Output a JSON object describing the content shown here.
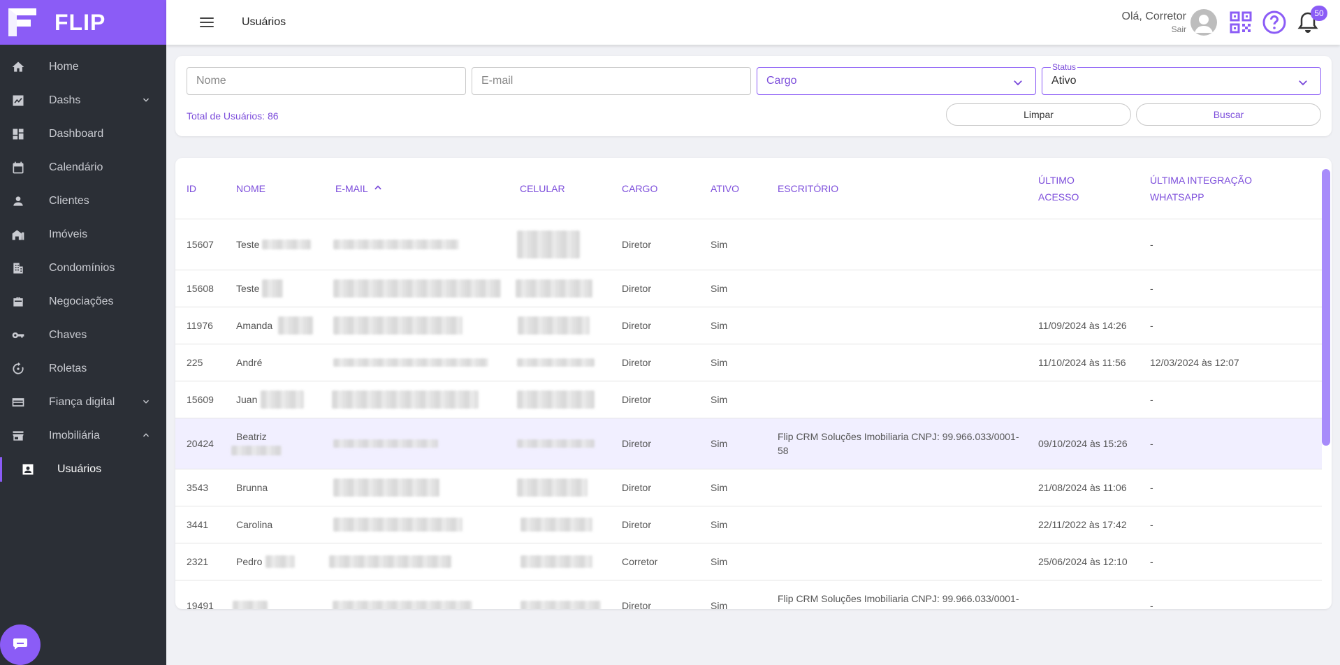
{
  "brand": {
    "name": "FLIP",
    "accent": "#8b5cf6"
  },
  "sidebar": {
    "items": [
      {
        "label": "Home",
        "icon": "home-icon"
      },
      {
        "label": "Dashs",
        "icon": "chart-icon"
      },
      {
        "label": "Dashboard",
        "icon": "dashboard-icon"
      },
      {
        "label": "Calendário",
        "icon": "calendar-icon"
      },
      {
        "label": "Clientes",
        "icon": "person-icon"
      },
      {
        "label": "Imóveis",
        "icon": "house-icon"
      },
      {
        "label": "Condomínios",
        "icon": "building-icon"
      },
      {
        "label": "Negociações",
        "icon": "briefcase-icon"
      },
      {
        "label": "Chaves",
        "icon": "key-icon"
      },
      {
        "label": "Roletas",
        "icon": "roulette-icon"
      },
      {
        "label": "Fiança digital",
        "icon": "credit-card-icon"
      },
      {
        "label": "Imobiliária",
        "icon": "store-icon"
      },
      {
        "label": "Usuários",
        "icon": "user-badge-icon"
      }
    ]
  },
  "header": {
    "title": "Usuários",
    "greeting": "Olá, Corretor",
    "logout": "Sair",
    "notifications": "50"
  },
  "filters": {
    "name_placeholder": "Nome",
    "email_placeholder": "E-mail",
    "cargo_placeholder": "Cargo",
    "status_label": "Status",
    "status_value": "Ativo",
    "total": "Total de Usuários: 86",
    "clear": "Limpar",
    "search": "Buscar"
  },
  "table": {
    "headers": {
      "id": "ID",
      "nome": "NOME",
      "email": "E-MAIL",
      "celular": "CELULAR",
      "cargo": "CARGO",
      "ativo": "ATIVO",
      "escritorio": "ESCRITÓRIO",
      "ultimo_acesso_1": "ÚLTIMO",
      "ultimo_acesso_2": "ACESSO",
      "integracao_1": "ÚLTIMA INTEGRAÇÃO",
      "integracao_2": "WHATSAPP"
    },
    "rows": [
      {
        "id": "15607",
        "nome": "Teste",
        "cargo": "Diretor",
        "ativo": "Sim",
        "escritorio": "",
        "acesso": "",
        "whatsapp": "-"
      },
      {
        "id": "15608",
        "nome": "Teste",
        "cargo": "Diretor",
        "ativo": "Sim",
        "escritorio": "",
        "acesso": "",
        "whatsapp": "-"
      },
      {
        "id": "11976",
        "nome": "Amanda",
        "cargo": "Diretor",
        "ativo": "Sim",
        "escritorio": "",
        "acesso": "11/09/2024 às 14:26",
        "whatsapp": "-"
      },
      {
        "id": "225",
        "nome": "André",
        "cargo": "Diretor",
        "ativo": "Sim",
        "escritorio": "",
        "acesso": "11/10/2024 às 11:56",
        "whatsapp": "12/03/2024 às 12:07"
      },
      {
        "id": "15609",
        "nome": "Juan",
        "cargo": "Diretor",
        "ativo": "Sim",
        "escritorio": "",
        "acesso": "",
        "whatsapp": "-"
      },
      {
        "id": "20424",
        "nome": "Beatriz",
        "cargo": "Diretor",
        "ativo": "Sim",
        "escritorio": "Flip CRM Soluções Imobiliaria CNPJ: 99.966.033/0001-58",
        "acesso": "09/10/2024 às 15:26",
        "whatsapp": "-"
      },
      {
        "id": "3543",
        "nome": "Brunna",
        "cargo": "Diretor",
        "ativo": "Sim",
        "escritorio": "",
        "acesso": "21/08/2024 às 11:06",
        "whatsapp": "-"
      },
      {
        "id": "3441",
        "nome": "Carolina",
        "cargo": "Diretor",
        "ativo": "Sim",
        "escritorio": "",
        "acesso": "22/11/2022 às 17:42",
        "whatsapp": "-"
      },
      {
        "id": "2321",
        "nome": "Pedro",
        "cargo": "Corretor",
        "ativo": "Sim",
        "escritorio": "",
        "acesso": "25/06/2024 às 12:10",
        "whatsapp": "-"
      },
      {
        "id": "19491",
        "nome": "",
        "cargo": "Diretor",
        "ativo": "Sim",
        "escritorio": "Flip CRM Soluções Imobiliaria CNPJ: 99.966.033/0001-",
        "acesso": "",
        "whatsapp": "-"
      }
    ]
  }
}
